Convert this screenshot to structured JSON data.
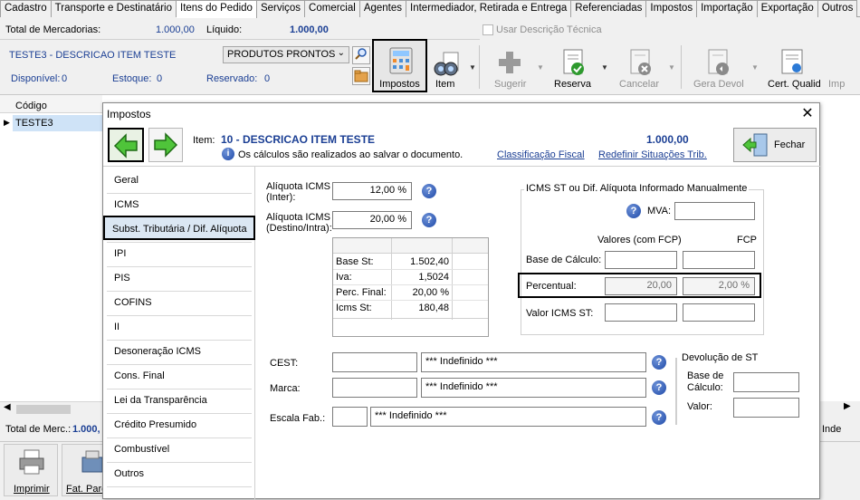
{
  "tabs": [
    "Cadastro",
    "Transporte e Destinatário",
    "Itens do Pedido",
    "Serviços",
    "Comercial",
    "Agentes",
    "Intermediador, Retirada e Entrega",
    "Referenciadas",
    "Impostos",
    "Importação",
    "Exportação",
    "Outros"
  ],
  "summary": {
    "total_mercadorias_label": "Total de Mercadorias:",
    "total_mercadorias_value": "1.000,00",
    "liquido_label": "Líquido:",
    "liquido_value": "1.000,00",
    "usar_descricao_label": "Usar Descrição Técnica"
  },
  "item_bar": {
    "item_name": "TESTE3 - DESCRICAO ITEM TESTE",
    "combo_value": "PRODUTOS PRONTOS",
    "disponivel_label": "Disponível:",
    "disponivel_value": "0",
    "estoque_label": "Estoque:",
    "estoque_value": "0",
    "reservado_label": "Reservado:",
    "reservado_value": "0"
  },
  "toolbar": {
    "impostos": "Impostos",
    "item": "Item",
    "sugerir": "Sugerir",
    "reserva": "Reserva",
    "cancelar": "Cancelar",
    "gera_devol": "Gera Devol",
    "cert_qualid": "Cert. Qualid",
    "truncated": "Imp"
  },
  "grid": {
    "header": "Código",
    "row": "TESTE3"
  },
  "bottom": {
    "total_merc_label": "Total de Merc.:",
    "total_merc_value": "1.000,",
    "truncated_right": "Inde",
    "imprimir": "Imprimir",
    "fat_parc": "Fat. Parc"
  },
  "dialog": {
    "title": "Impostos",
    "item_label": "Item:",
    "item_value": "10 - DESCRICAO ITEM TESTE",
    "item_total": "1.000,00",
    "info_text": "Os cálculos são realizados ao salvar o documento.",
    "link_classificacao": "Classificação Fiscal",
    "link_redefinir": "Redefinir Situações Trib.",
    "fechar": "Fechar",
    "nav": [
      "Geral",
      "ICMS",
      "Subst. Tributária / Dif. Alíquota",
      "IPI",
      "PIS",
      "COFINS",
      "II",
      "Desoneração ICMS",
      "Cons. Final",
      "Lei da Transparência",
      "Crédito Presumido",
      "Combustível",
      "Outros"
    ],
    "aliq_inter_label": "Alíquota ICMS\n(Inter):",
    "aliq_inter_value": "12,00 %",
    "aliq_destino_label": "Alíquota ICMS\n(Destino/Intra):",
    "aliq_destino_value": "20,00 %",
    "calc": [
      {
        "label": "Base St:",
        "value": "1.502,40"
      },
      {
        "label": "Iva:",
        "value": "1,5024"
      },
      {
        "label": "Perc. Final:",
        "value": "20,00 %"
      },
      {
        "label": "Icms St:",
        "value": "180,48"
      }
    ],
    "manual_group_title": "ICMS ST ou Dif. Alíquota Informado Manualmente",
    "mva_label": "MVA:",
    "col_valores": "Valores (com FCP)",
    "col_fcp": "FCP",
    "base_calculo_label": "Base de Cálculo:",
    "percentual_label": "Percentual:",
    "percentual_value": "20,00",
    "percentual_fcp": "2,00 %",
    "valor_icms_st_label": "Valor ICMS ST:",
    "cest_label": "CEST:",
    "cest_desc": "*** Indefinido ***",
    "marca_label": "Marca:",
    "marca_desc": "*** Indefinido ***",
    "escala_label": "Escala Fab.:",
    "escala_desc": "*** Indefinido ***",
    "devol_title": "Devolução de  ST",
    "devol_base_label": "Base de\nCálculo:",
    "devol_valor_label": "Valor:"
  },
  "colors": {
    "highlight_border": "#000000",
    "link": "#1b3f94",
    "grid_row": "#cfe3f7"
  }
}
